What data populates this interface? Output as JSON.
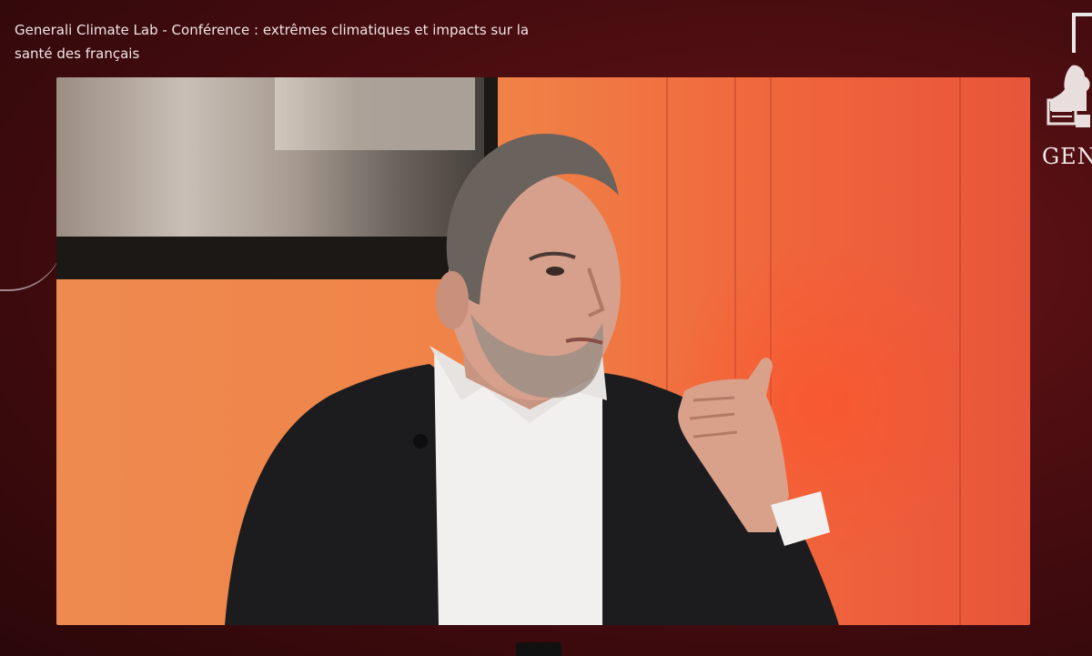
{
  "window": {
    "title": "Generali Climate Lab - Conférence : extrêmes climatiques et impacts sur la santé des français"
  },
  "logo": {
    "text": "GENERALI",
    "icon": "lion-of-saint-mark-icon"
  },
  "icons": {
    "fullscreen": "fullscreen-corner-icon"
  },
  "colors": {
    "background": "#4a0d10",
    "accent": "#c0151d",
    "set_orange": "#f08347"
  }
}
